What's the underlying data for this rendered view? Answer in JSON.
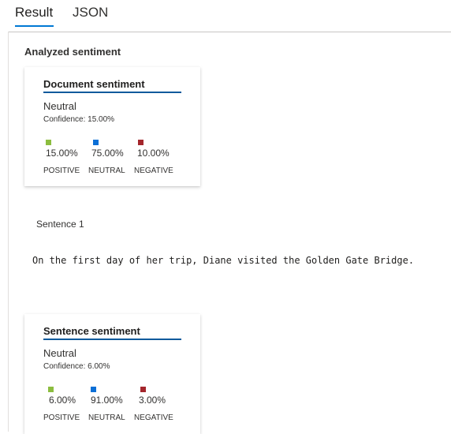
{
  "tabs": {
    "result": "Result",
    "json": "JSON"
  },
  "section_title": "Analyzed sentiment",
  "document_card": {
    "title": "Document sentiment",
    "label": "Neutral",
    "confidence": "Confidence: 15.00%",
    "scores": [
      {
        "value": "15.00%",
        "category": "POSITIVE",
        "color": "#8cbd3f"
      },
      {
        "value": "75.00%",
        "category": "NEUTRAL",
        "color": "#0b6fd6"
      },
      {
        "value": "10.00%",
        "category": "NEGATIVE",
        "color": "#a4262c"
      }
    ]
  },
  "sentence": {
    "label": "Sentence 1",
    "text": "On the first day of her trip, Diane visited the Golden Gate Bridge."
  },
  "sentence_card": {
    "title": "Sentence sentiment",
    "label": "Neutral",
    "confidence": "Confidence: 6.00%",
    "scores": [
      {
        "value": "6.00%",
        "category": "POSITIVE",
        "color": "#8cbd3f"
      },
      {
        "value": "91.00%",
        "category": "NEUTRAL",
        "color": "#0b6fd6"
      },
      {
        "value": "3.00%",
        "category": "NEGATIVE",
        "color": "#a4262c"
      }
    ]
  }
}
